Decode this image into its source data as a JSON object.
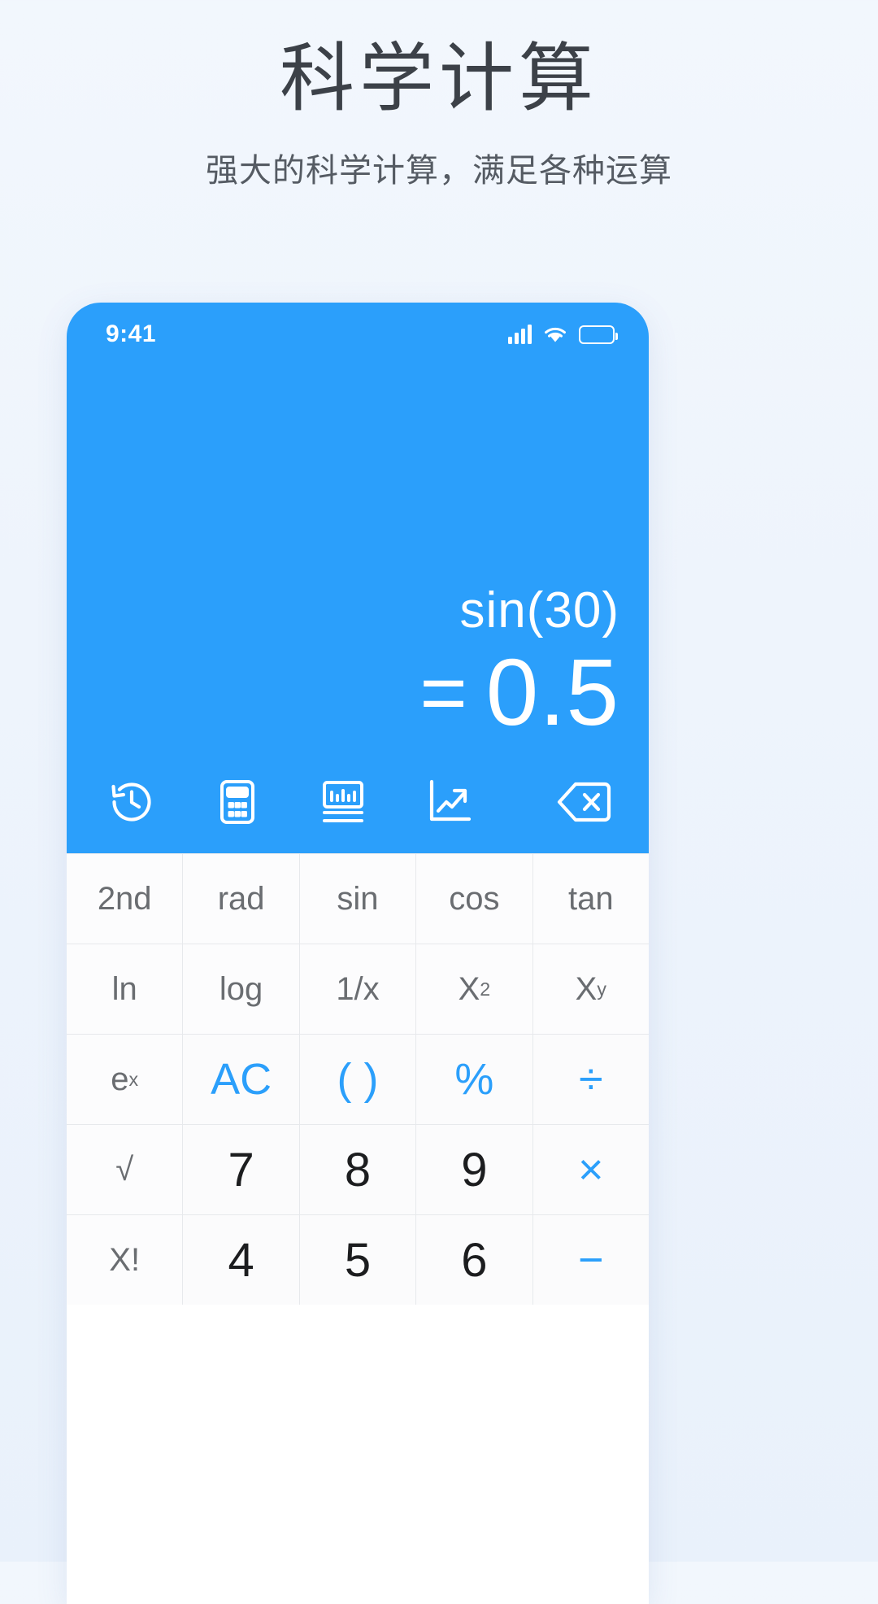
{
  "promo": {
    "title": "科学计算",
    "subtitle": "强大的科学计算，满足各种运算"
  },
  "phone": {
    "status": {
      "time": "9:41",
      "signal_icon": "cellular-signal-icon",
      "wifi_icon": "wifi-icon",
      "battery_icon": "battery-full-icon"
    },
    "display": {
      "expression": "sin(30)",
      "equals_sign": "=",
      "result": "0.5",
      "accent_color": "#2b9ffb"
    },
    "toolbar": {
      "items": [
        {
          "name": "history-icon",
          "label": "history"
        },
        {
          "name": "calculator-icon",
          "label": "calculator"
        },
        {
          "name": "unit-converter-icon",
          "label": "converter"
        },
        {
          "name": "chart-trend-icon",
          "label": "trend"
        }
      ],
      "backspace": {
        "name": "backspace-icon",
        "label": "backspace"
      }
    },
    "keypad": {
      "rows": [
        [
          {
            "label": "2nd",
            "style": "fn"
          },
          {
            "label": "rad",
            "style": "fn"
          },
          {
            "label": "sin",
            "style": "fn"
          },
          {
            "label": "cos",
            "style": "fn"
          },
          {
            "label": "tan",
            "style": "fn"
          }
        ],
        [
          {
            "label": "ln",
            "style": "fn"
          },
          {
            "label": "log",
            "style": "fn"
          },
          {
            "label": "1/x",
            "style": "fn"
          },
          {
            "label": "X",
            "sup": "2",
            "style": "fn"
          },
          {
            "label": "X",
            "sup": "y",
            "style": "fn"
          }
        ],
        [
          {
            "label": "e",
            "sup": "x",
            "style": "fn"
          },
          {
            "label": "AC",
            "style": "accent"
          },
          {
            "label": "( )",
            "style": "accent"
          },
          {
            "label": "%",
            "style": "accent"
          },
          {
            "label": "÷",
            "style": "accent-op"
          }
        ],
        [
          {
            "label": "√",
            "style": "fn"
          },
          {
            "label": "7",
            "style": "num"
          },
          {
            "label": "8",
            "style": "num"
          },
          {
            "label": "9",
            "style": "num"
          },
          {
            "label": "×",
            "style": "accent-op"
          }
        ],
        [
          {
            "label": "X!",
            "style": "fn"
          },
          {
            "label": "4",
            "style": "num"
          },
          {
            "label": "5",
            "style": "num"
          },
          {
            "label": "6",
            "style": "num"
          },
          {
            "label": "−",
            "style": "accent-op"
          }
        ]
      ]
    }
  }
}
